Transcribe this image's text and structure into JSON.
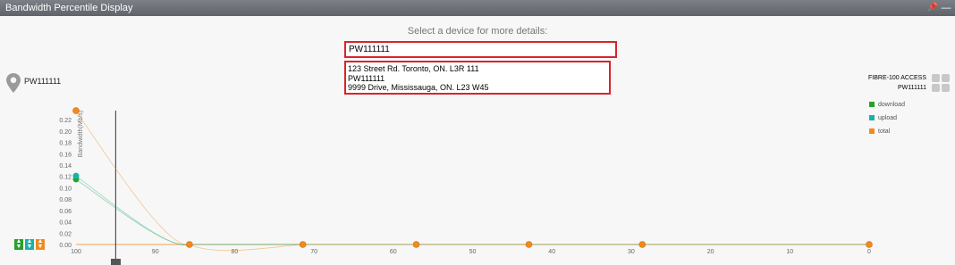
{
  "window": {
    "title": "Bandwidth Percentile Display"
  },
  "device_selector": {
    "prompt": "Select a device for more details:",
    "value": "PW111111"
  },
  "device_info": {
    "lines": [
      "123 Street Rd. Toronto, ON. L3R 111",
      "PW111111",
      "9999 Drive, Mississauga, ON. L23 W45"
    ]
  },
  "selected_device": {
    "name": "PW111111"
  },
  "device_legend": [
    {
      "label": "FIBRE-100 ACCESS"
    },
    {
      "label": "PW111111"
    }
  ],
  "colors": {
    "download": "#2aa02a",
    "upload": "#17b3a8",
    "total": "#f08a1c",
    "title_bar": "#6b6f76",
    "highlight_border": "#d9232a"
  },
  "chart_data": {
    "type": "line",
    "ylabel": "Bandwidth(Mb/s)",
    "xlabel": "",
    "xlim": [
      100,
      0
    ],
    "ylim": [
      0,
      0.23
    ],
    "x_ticks": [
      100,
      90,
      80,
      70,
      60,
      50,
      40,
      30,
      20,
      10,
      0
    ],
    "y_ticks": [
      "0.22",
      "0.20",
      "0.18",
      "0.16",
      "0.14",
      "0.12",
      "0.10",
      "0.08",
      "0.06",
      "0.04",
      "0.02",
      "0.00"
    ],
    "legend_position": "right",
    "series": [
      {
        "name": "download",
        "x": [
          100,
          85.7,
          71.4,
          57.1,
          42.9,
          28.6,
          0
        ],
        "values": [
          0.115,
          0,
          0,
          0,
          0,
          0,
          0
        ]
      },
      {
        "name": "upload",
        "x": [
          100,
          85.7,
          71.4,
          57.1,
          42.9,
          28.6,
          0
        ],
        "values": [
          0.121,
          0,
          0,
          0,
          0,
          0,
          0
        ]
      },
      {
        "name": "total",
        "x": [
          100,
          85.7,
          71.4,
          57.1,
          42.9,
          28.6,
          0
        ],
        "values": [
          0.236,
          0,
          0,
          0,
          0,
          0,
          0
        ]
      }
    ],
    "cursor_x": 95
  },
  "icons": {
    "pin": "location-pin-icon",
    "window_pin": "pushpin-icon",
    "minimize": "minimize-icon"
  }
}
